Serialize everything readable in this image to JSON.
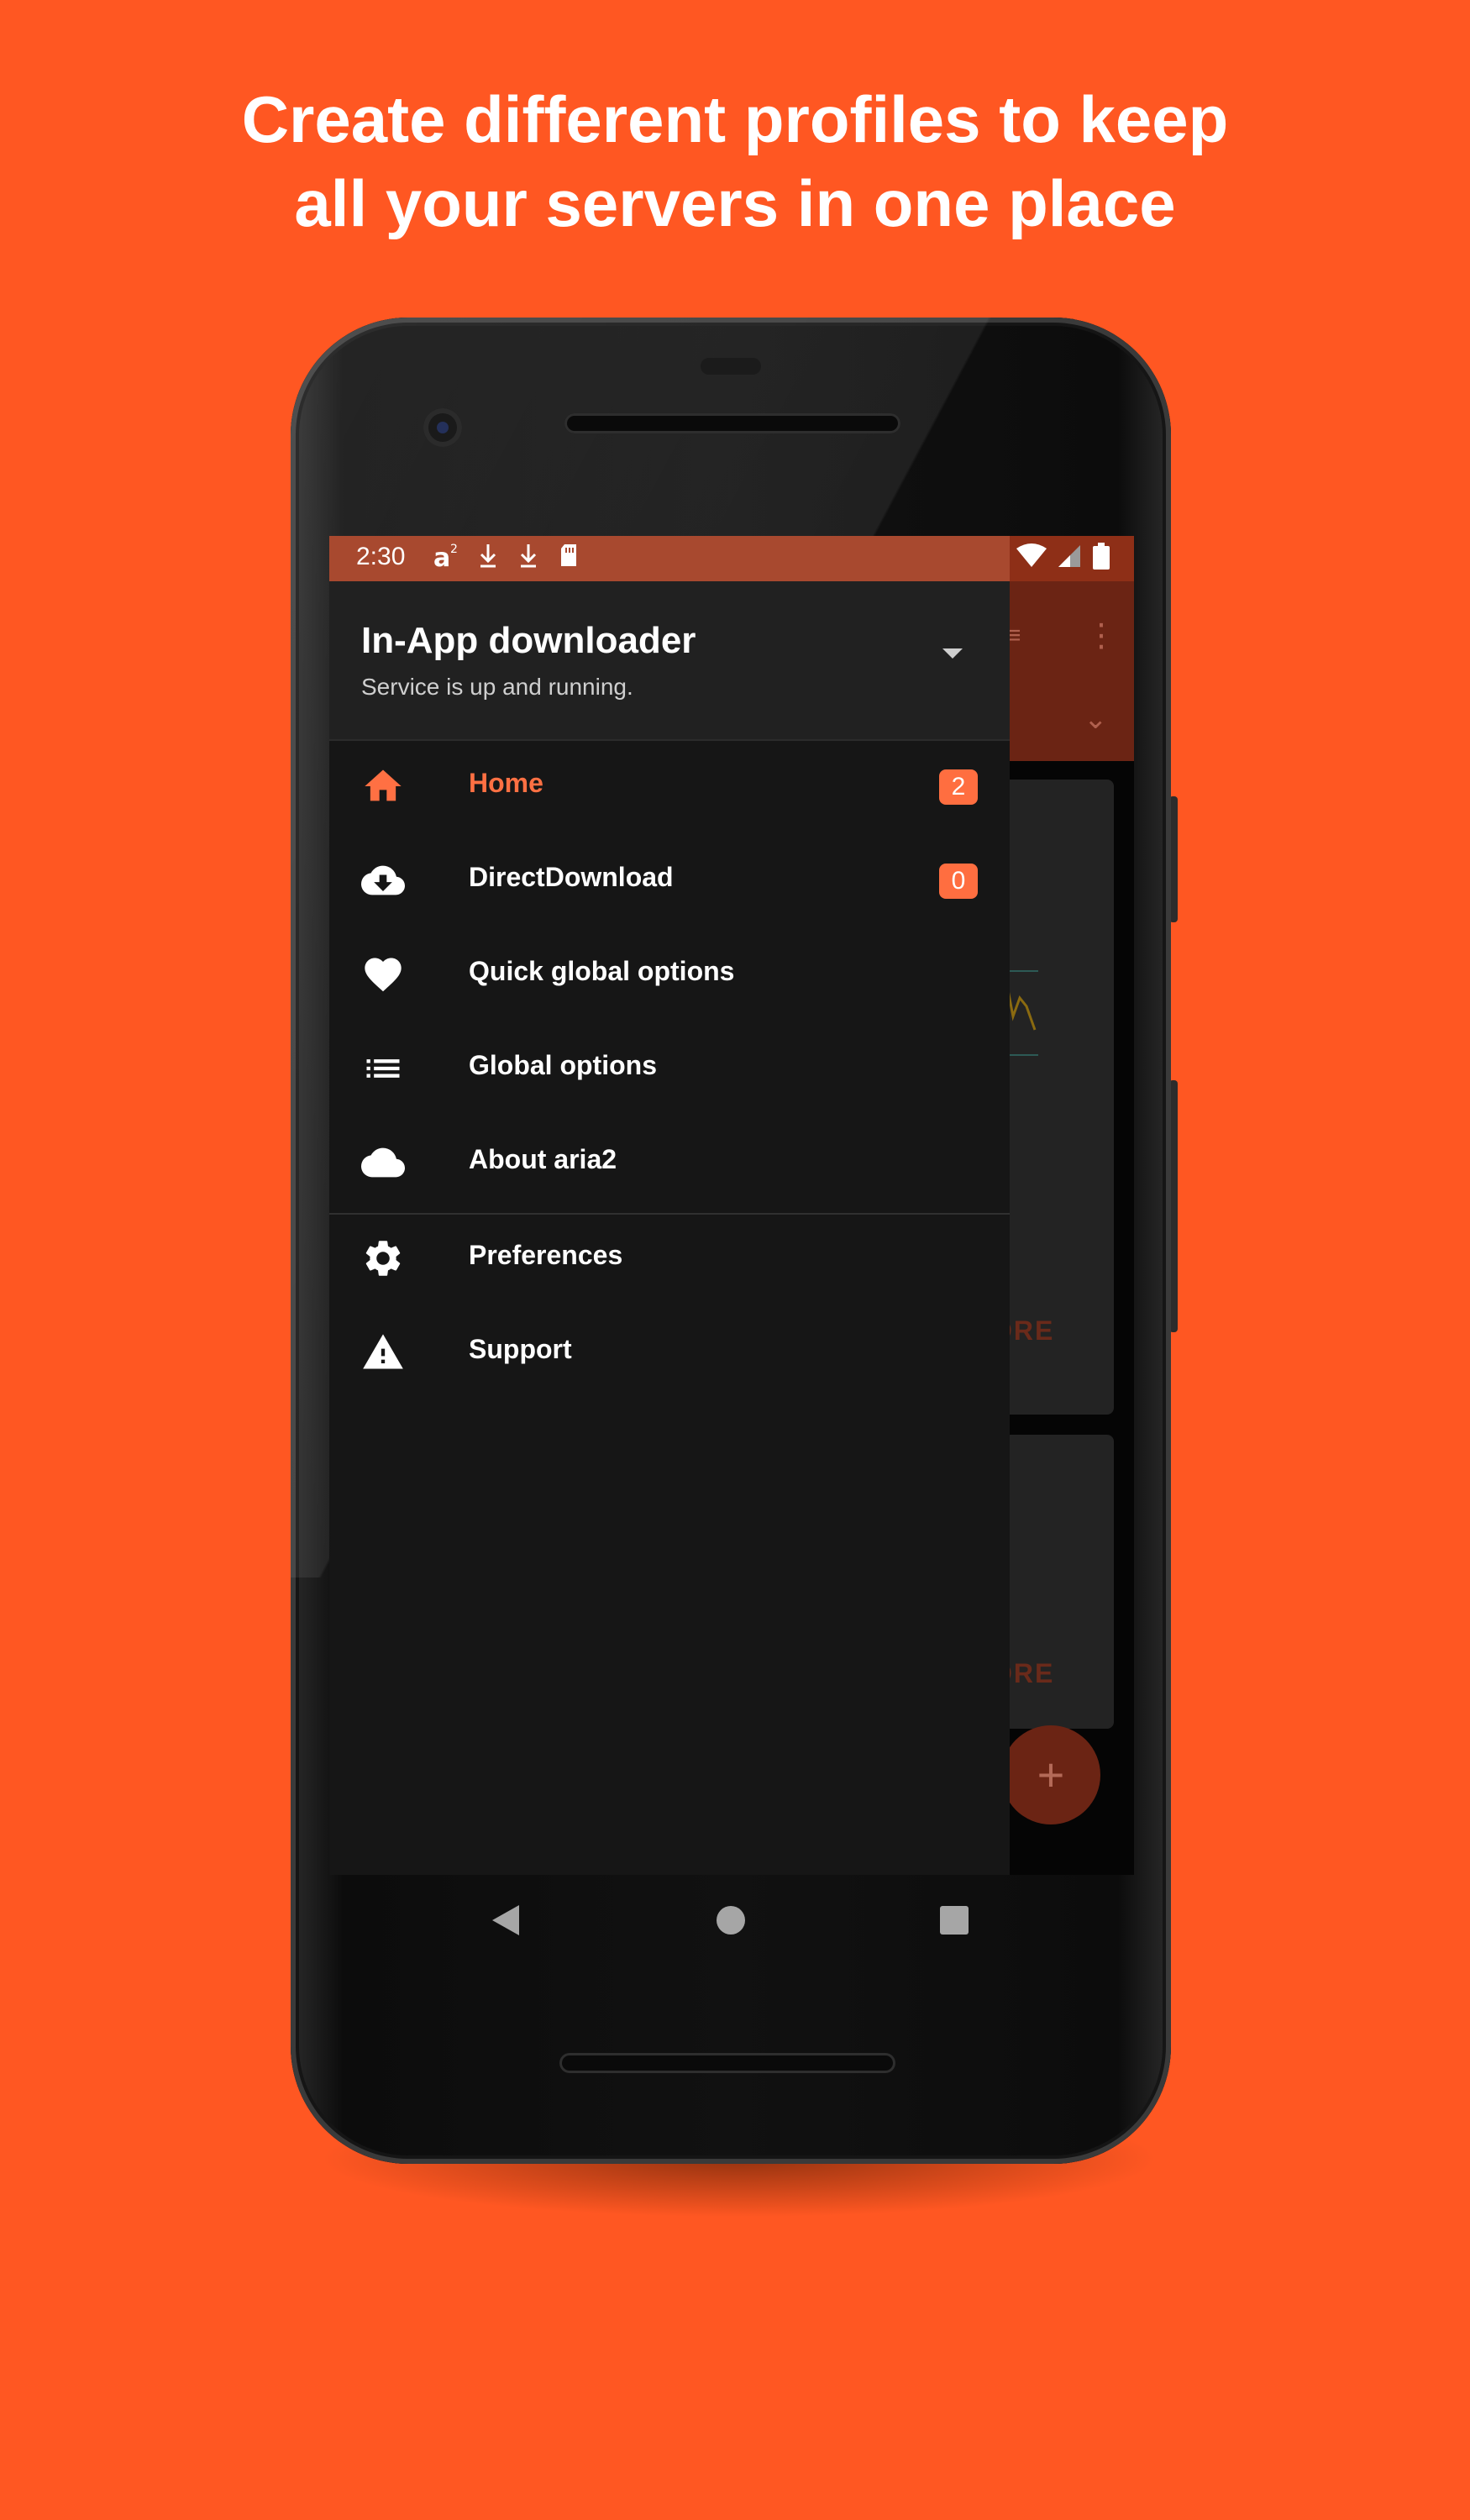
{
  "headline": {
    "line1": "Create different profiles to keep",
    "line2": "all your servers in one place"
  },
  "status_bar": {
    "time": "2:30",
    "left_icons": [
      "aria2-icon",
      "download-icon",
      "download-icon",
      "sd-card-icon"
    ],
    "right_icons": [
      "wifi-icon",
      "signal-icon",
      "battery-icon"
    ]
  },
  "drawer": {
    "profile": {
      "name": "In-App downloader",
      "status": "Service is up and running."
    },
    "items": [
      {
        "label": "Home",
        "icon": "home-icon",
        "badge": "2",
        "active": true
      },
      {
        "label": "DirectDownload",
        "icon": "cloud-download-icon",
        "badge": "0",
        "active": false
      },
      {
        "label": "Quick global options",
        "icon": "heart-icon",
        "active": false
      },
      {
        "label": "Global options",
        "icon": "list-icon",
        "active": false
      },
      {
        "label": "About aria2",
        "icon": "cloud-icon",
        "active": false
      }
    ],
    "secondary_items": [
      {
        "label": "Preferences",
        "icon": "gear-icon"
      },
      {
        "label": "Support",
        "icon": "warning-icon"
      }
    ]
  },
  "background_app": {
    "card_action_1": "ORE",
    "card_action_2": "ORE",
    "fab": "+"
  },
  "colors": {
    "background": "#FF5722",
    "accent": "#FF6E40",
    "drawer": "#161616",
    "status_bar": "#A8492F"
  }
}
